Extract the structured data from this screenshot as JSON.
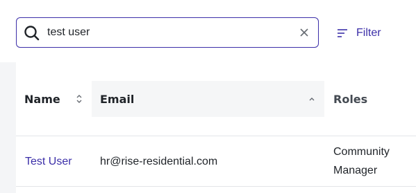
{
  "search": {
    "value": "test user",
    "icon": "search-icon",
    "clear_icon": "close-icon"
  },
  "filter": {
    "label": "Filter",
    "icon": "filter-icon"
  },
  "table": {
    "columns": [
      {
        "label": "Name",
        "sort": "unsorted"
      },
      {
        "label": "Email",
        "sort": "ascending"
      },
      {
        "label": "Roles",
        "sort": "none"
      }
    ],
    "rows": [
      {
        "name": "Test User",
        "email": "hr@rise-residential.com",
        "roles": "Community Manager"
      }
    ]
  },
  "colors": {
    "accent": "#3b2ea8",
    "header_highlight": "#f5f6f7",
    "text": "#1f2328"
  }
}
